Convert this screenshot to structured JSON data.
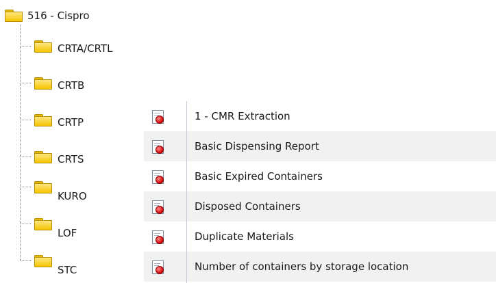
{
  "tree": {
    "root": {
      "label": "516 - Cispro",
      "icon": "folder-icon"
    },
    "children": [
      {
        "label": "CRTA/CRTL",
        "icon": "folder-icon"
      },
      {
        "label": "CRTB",
        "icon": "folder-icon"
      },
      {
        "label": "CRTP",
        "icon": "folder-icon"
      },
      {
        "label": "CRTS",
        "icon": "folder-icon"
      },
      {
        "label": "KURO",
        "icon": "folder-icon"
      },
      {
        "label": "LOF",
        "icon": "folder-icon"
      },
      {
        "label": "STC",
        "icon": "folder-icon"
      }
    ]
  },
  "reports": {
    "icon": "report-icon",
    "items": [
      {
        "label": "1 - CMR Extraction"
      },
      {
        "label": "Basic Dispensing Report"
      },
      {
        "label": "Basic Expired Containers"
      },
      {
        "label": "Disposed Containers"
      },
      {
        "label": "Duplicate Materials"
      },
      {
        "label": "Number of containers by storage location"
      }
    ]
  },
  "colors": {
    "folder": "#f5c400",
    "alt_row": "#f1f1f1",
    "report_dot": "#d40000"
  }
}
